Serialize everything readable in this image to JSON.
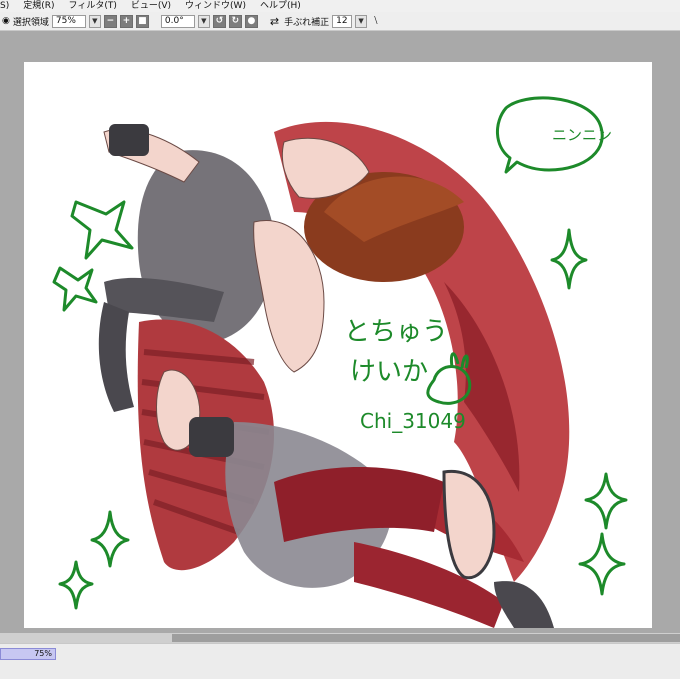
{
  "menu": {
    "items": [
      "S)",
      "定規(R)",
      "フィルタ(T)",
      "ビュー(V)",
      "ウィンドウ(W)",
      "ヘルプ(H)"
    ]
  },
  "tool_options": {
    "eye_icon": "eye-icon",
    "selection_label": "選択領域",
    "zoom_value": "75%",
    "zoom_minus": "−",
    "zoom_plus": "+",
    "rotation_value": "0.0°",
    "flip_icon": "flip-horizontal-icon",
    "stabilizer_label": "手ぶれ補正",
    "stabilizer_value": "12",
    "brush_icon": "brush-stroke-icon"
  },
  "artwork": {
    "bubble_text": "ニンニン",
    "handwriting_line1": "とちゅう",
    "handwriting_line2": "けいか",
    "signature": "Chi_31049",
    "colors": {
      "scarf": "#b8343a",
      "hair": "#8a3b1e",
      "vest": "#6f6c72",
      "skin": "#f3d5cc",
      "stroke_green": "#1d8a2a"
    }
  },
  "status": {
    "zoom_readout": "75%"
  }
}
